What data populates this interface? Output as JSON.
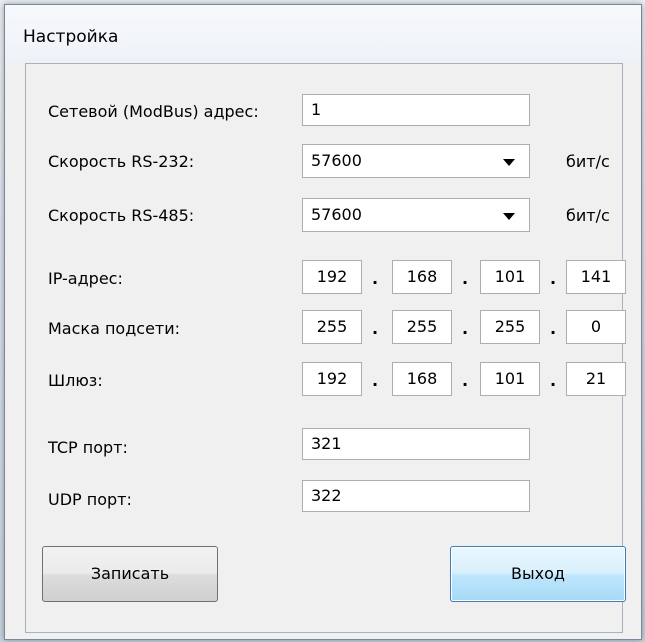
{
  "window": {
    "title": "Настройка"
  },
  "form": {
    "modbus_label": "Сетевой (ModBus) адрес:",
    "modbus_value": "1",
    "rs232_label": "Скорость RS-232:",
    "rs232_value": "57600",
    "rs232_unit": "бит/с",
    "rs485_label": "Скорость RS-485:",
    "rs485_value": "57600",
    "rs485_unit": "бит/с",
    "ip_label": "IP-адрес:",
    "ip": [
      "192",
      "168",
      "101",
      "141"
    ],
    "mask_label": "Маска подсети:",
    "mask": [
      "255",
      "255",
      "255",
      "0"
    ],
    "gateway_label": "Шлюз:",
    "gateway": [
      "192",
      "168",
      "101",
      "21"
    ],
    "dot": ".",
    "tcp_label": "TCP порт:",
    "tcp_value": "321",
    "udp_label": "UDP порт:",
    "udp_value": "322"
  },
  "buttons": {
    "write_label": "Записать",
    "exit_label": "Выход"
  },
  "icons": {
    "dropdown": "chevron-down-icon"
  }
}
